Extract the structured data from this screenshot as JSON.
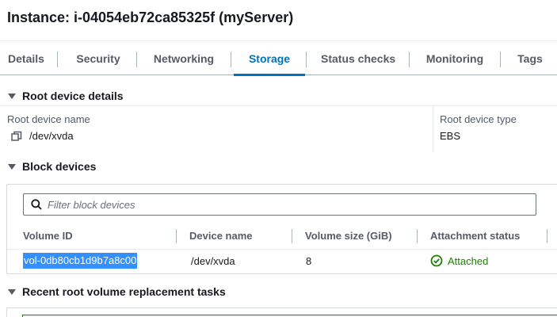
{
  "header": {
    "title": "Instance: i-04054eb72ca85325f (myServer)"
  },
  "tabs": [
    {
      "label": "Details"
    },
    {
      "label": "Security"
    },
    {
      "label": "Networking"
    },
    {
      "label": "Storage"
    },
    {
      "label": "Status checks"
    },
    {
      "label": "Monitoring"
    },
    {
      "label": "Tags"
    }
  ],
  "active_tab": "Storage",
  "root_device": {
    "heading": "Root device details",
    "name_label": "Root device name",
    "name_value": "/dev/xvda",
    "type_label": "Root device type",
    "type_value": "EBS"
  },
  "block_devices": {
    "heading": "Block devices",
    "filter_placeholder": "Filter block devices",
    "columns": [
      "Volume ID",
      "Device name",
      "Volume size (GiB)",
      "Attachment status"
    ],
    "rows": [
      {
        "volume_id": "vol-0db80cb1d9b7a8c00",
        "device_name": "/dev/xvda",
        "size": "8",
        "status": "Attached"
      }
    ]
  },
  "recent_tasks": {
    "heading": "Recent root volume replacement tasks"
  },
  "colors": {
    "accent": "#0073bb",
    "success": "#1d8102",
    "selection": "#3390ff"
  },
  "icons": {
    "copy": "copy-icon",
    "search": "search-icon",
    "status_ok": "check-circle-icon",
    "caret": "caret-down-icon"
  }
}
